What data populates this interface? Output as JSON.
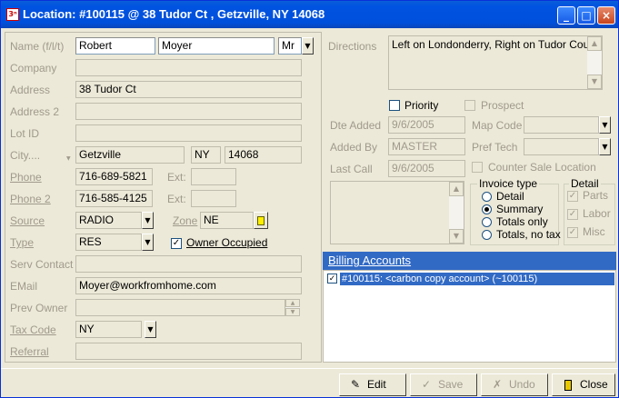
{
  "window": {
    "title": "Location: #100115 @ 38 Tudor Ct , Getzville, NY  14068",
    "icon_text": "3ⁿ",
    "controls": {
      "minimize": "_",
      "maximize": "□",
      "close": "×"
    }
  },
  "left": {
    "name": {
      "label": "Name (f/l/t)",
      "first": "Robert",
      "last": "Moyer",
      "title": "Mr"
    },
    "company": {
      "label": "Company",
      "value": ""
    },
    "address": {
      "label": "Address",
      "value": "38 Tudor Ct"
    },
    "address2": {
      "label": "Address 2",
      "value": ""
    },
    "lot_id": {
      "label": "Lot ID",
      "value": ""
    },
    "city": {
      "label": "City....",
      "value": "Getzville",
      "state": "NY",
      "zip": "14068"
    },
    "phone": {
      "label": "Phone",
      "value": "716-689-5821",
      "ext_label": "Ext:",
      "ext": ""
    },
    "phone2": {
      "label": "Phone 2",
      "value": "716-585-4125",
      "ext_label": "Ext:",
      "ext": ""
    },
    "source": {
      "label": "Source",
      "value": "RADIO"
    },
    "zone": {
      "label": "Zone",
      "value": "NE"
    },
    "type": {
      "label": "Type",
      "value": "RES"
    },
    "owner_occupied": {
      "label": "Owner Occupied",
      "checked": true
    },
    "serv_contact": {
      "label": "Serv Contact",
      "value": ""
    },
    "email": {
      "label": "EMail",
      "value": "Moyer@workfromhome.com"
    },
    "prev_owner": {
      "label": "Prev Owner",
      "value": ""
    },
    "tax_code": {
      "label": "Tax Code",
      "value": "NY"
    },
    "referral": {
      "label": "Referral",
      "value": ""
    }
  },
  "right": {
    "directions": {
      "label": "Directions",
      "value": "Left on Londonderry, Right on Tudor Court"
    },
    "priority": {
      "label": "Priority",
      "checked": false
    },
    "prospect": {
      "label": "Prospect",
      "checked": false
    },
    "date_added": {
      "label": "Dte Added",
      "value": "9/6/2005"
    },
    "map_code": {
      "label": "Map Code",
      "value": ""
    },
    "added_by": {
      "label": "Added By",
      "value": "MASTER"
    },
    "pref_tech": {
      "label": "Pref Tech",
      "value": ""
    },
    "last_call": {
      "label": "Last Call",
      "value": "9/6/2005"
    },
    "counter_sale": {
      "label": "Counter Sale Location",
      "checked": false
    },
    "invoice_type": {
      "title": "Invoice type",
      "options": [
        "Detail",
        "Summary",
        "Totals only",
        "Totals, no tax"
      ],
      "selected": "Summary"
    },
    "detail": {
      "title": "Detail",
      "items": [
        {
          "label": "Parts",
          "checked": true
        },
        {
          "label": "Labor",
          "checked": true
        },
        {
          "label": "Misc",
          "checked": true
        }
      ]
    },
    "billing": {
      "title": "Billing Accounts",
      "rows": [
        {
          "checked": true,
          "text": "#100115: <carbon copy account> (~100115)"
        }
      ]
    }
  },
  "footer": {
    "edit": "Edit",
    "save": "Save",
    "undo": "Undo",
    "close": "Close"
  },
  "colors": {
    "title_bar": "#0054e3",
    "billing_header": "#316ac5",
    "selection": "#316ac5"
  }
}
